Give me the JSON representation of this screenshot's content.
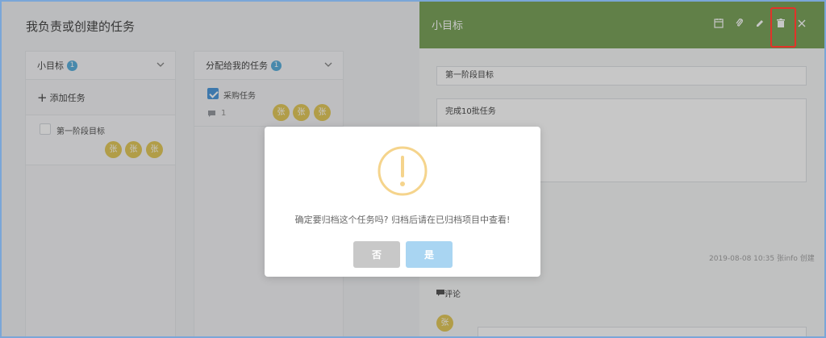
{
  "page": {
    "title": "我负责或创建的任务"
  },
  "columns": [
    {
      "title": "小目标",
      "badge": "1",
      "add_label": "添加任务",
      "tasks": [
        {
          "title": "第一阶段目标",
          "checked": false,
          "assignees": [
            "张",
            "张",
            "张"
          ]
        }
      ]
    },
    {
      "title": "分配给我的任务",
      "badge": "1",
      "tasks": [
        {
          "title": "采购任务",
          "checked": true,
          "comments": "1",
          "assignees": [
            "张",
            "张",
            "张"
          ]
        }
      ]
    }
  ],
  "panel": {
    "title": "小目标",
    "toolbar": [
      "calendar-icon",
      "paperclip-icon",
      "pencil-icon",
      "trash-icon",
      "close-icon"
    ],
    "task_name": "第一阶段目标",
    "description": "完成10批任务",
    "meta": "2019-08-08 10:35 张info 创建",
    "comments_label": "评论",
    "avatar": "张"
  },
  "dialog": {
    "message": "确定要归档这个任务吗? 归档后请在已归档项目中查看!",
    "no_label": "否",
    "yes_label": "是"
  },
  "colors": {
    "panel_header": "#6e9a4a",
    "avatar": "#e0c349",
    "badge": "#4aa7d8",
    "warning": "#f5d48c",
    "highlight": "#e2332a",
    "yes_button": "#a9d5f2",
    "no_button": "#c8c8c8"
  }
}
